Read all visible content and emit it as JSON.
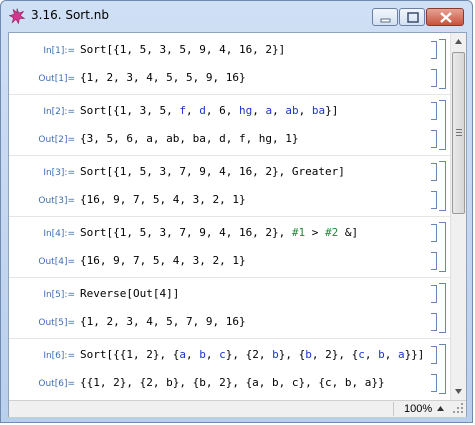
{
  "window": {
    "title": "3.16. Sort.nb",
    "icon": "mathematica-star-icon",
    "accent": "#d2378d",
    "controls": [
      "minimize",
      "maximize",
      "close"
    ]
  },
  "cells": [
    {
      "in_label": "In[1]:=",
      "input_parts": [
        {
          "t": "Sort[{1, 5, 3, 5, 9, 4, 16, 2}]",
          "c": "k"
        }
      ],
      "out_label": "Out[1]=",
      "output": "{1, 2, 3, 4, 5, 5, 9, 16}"
    },
    {
      "in_label": "In[2]:=",
      "input_parts": [
        {
          "t": "Sort[{1, 3, 5, ",
          "c": "k"
        },
        {
          "t": "f",
          "c": "b"
        },
        {
          "t": ", ",
          "c": "k"
        },
        {
          "t": "d",
          "c": "b"
        },
        {
          "t": ", 6, ",
          "c": "k"
        },
        {
          "t": "hg",
          "c": "b"
        },
        {
          "t": ", ",
          "c": "k"
        },
        {
          "t": "a",
          "c": "b"
        },
        {
          "t": ", ",
          "c": "k"
        },
        {
          "t": "ab",
          "c": "b"
        },
        {
          "t": ", ",
          "c": "k"
        },
        {
          "t": "ba",
          "c": "b"
        },
        {
          "t": "}]",
          "c": "k"
        }
      ],
      "out_label": "Out[2]=",
      "output": "{3, 5, 6, a, ab, ba, d, f, hg, 1}"
    },
    {
      "in_label": "In[3]:=",
      "input_parts": [
        {
          "t": "Sort[{1, 5, 3, 7, 9, 4, 16, 2}, Greater]",
          "c": "k"
        }
      ],
      "out_label": "Out[3]=",
      "output": "{16, 9, 7, 5, 4, 3, 2, 1}"
    },
    {
      "in_label": "In[4]:=",
      "input_parts": [
        {
          "t": "Sort[{1, 5, 3, 7, 9, 4, 16, 2}, ",
          "c": "k"
        },
        {
          "t": "#1",
          "c": "g"
        },
        {
          "t": " > ",
          "c": "k"
        },
        {
          "t": "#2",
          "c": "g"
        },
        {
          "t": " &]",
          "c": "k"
        }
      ],
      "out_label": "Out[4]=",
      "output": "{16, 9, 7, 5, 4, 3, 2, 1}"
    },
    {
      "in_label": "In[5]:=",
      "input_parts": [
        {
          "t": "Reverse[Out[4]]",
          "c": "k"
        }
      ],
      "out_label": "Out[5]=",
      "output": "{1, 2, 3, 4, 5, 7, 9, 16}"
    },
    {
      "in_label": "In[6]:=",
      "input_parts": [
        {
          "t": "Sort[{{1, 2}, {",
          "c": "k"
        },
        {
          "t": "a",
          "c": "b"
        },
        {
          "t": ", ",
          "c": "k"
        },
        {
          "t": "b",
          "c": "b"
        },
        {
          "t": ", ",
          "c": "k"
        },
        {
          "t": "c",
          "c": "b"
        },
        {
          "t": "}, {2, ",
          "c": "k"
        },
        {
          "t": "b",
          "c": "b"
        },
        {
          "t": "}, {",
          "c": "k"
        },
        {
          "t": "b",
          "c": "b"
        },
        {
          "t": ", 2}, {",
          "c": "k"
        },
        {
          "t": "c",
          "c": "b"
        },
        {
          "t": ", ",
          "c": "k"
        },
        {
          "t": "b",
          "c": "b"
        },
        {
          "t": ", ",
          "c": "k"
        },
        {
          "t": "a",
          "c": "b"
        },
        {
          "t": "}}]",
          "c": "k"
        }
      ],
      "out_label": "Out[6]=",
      "output": "{{1, 2}, {2, b}, {b, 2}, {a, b, c}, {c, b, a}}"
    }
  ],
  "status": {
    "zoom": "100%"
  }
}
